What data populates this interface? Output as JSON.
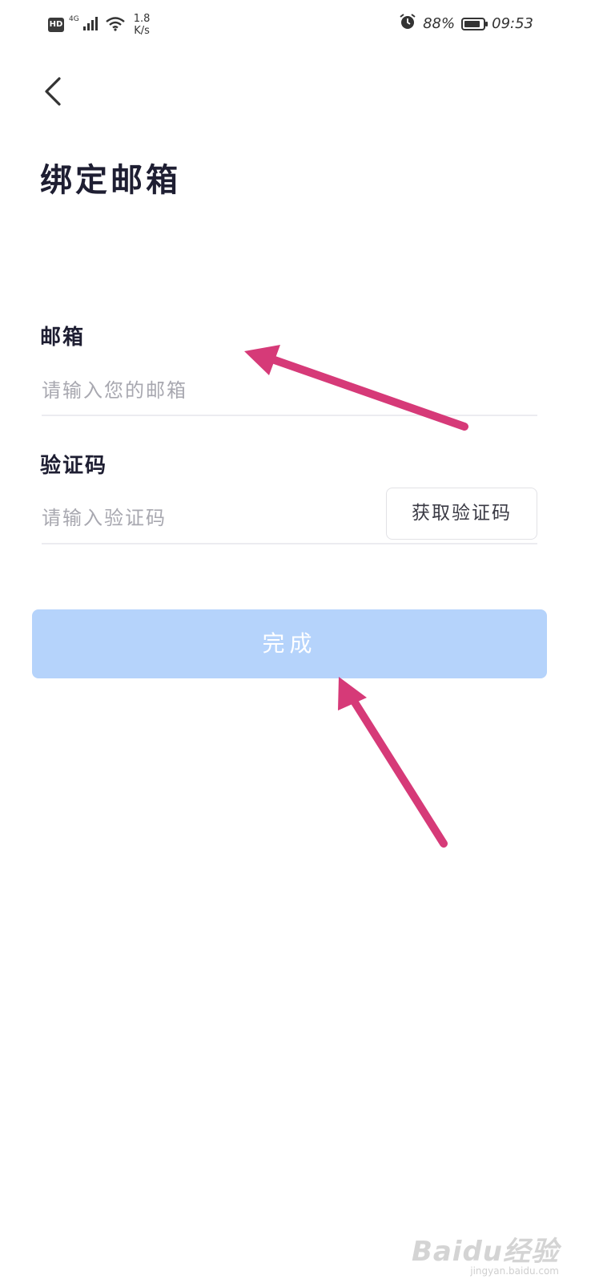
{
  "status_bar": {
    "hd": "HD",
    "network": "4G",
    "speed_value": "1.8",
    "speed_unit": "K/s",
    "battery_percent": "88%",
    "battery_level": 0.88,
    "time": "09:53",
    "icons": [
      "signal-icon",
      "wifi-icon",
      "alarm-icon",
      "battery-icon"
    ]
  },
  "header": {
    "back_icon": "chevron-left-icon",
    "title": "绑定邮箱"
  },
  "form": {
    "email": {
      "label": "邮箱",
      "placeholder": "请输入您的邮箱",
      "value": ""
    },
    "code": {
      "label": "验证码",
      "placeholder": "请输入验证码",
      "value": "",
      "get_code_label": "获取验证码"
    },
    "submit_label": "完成"
  },
  "annotations": {
    "arrow_color": "#d63a78"
  },
  "watermark": {
    "brand": "Baidu经验",
    "url": "jingyan.baidu.com"
  },
  "colors": {
    "primary_button": "#b5d3fb",
    "placeholder": "#a8a8b0",
    "divider": "#ececf0",
    "title": "#1e1e32"
  }
}
